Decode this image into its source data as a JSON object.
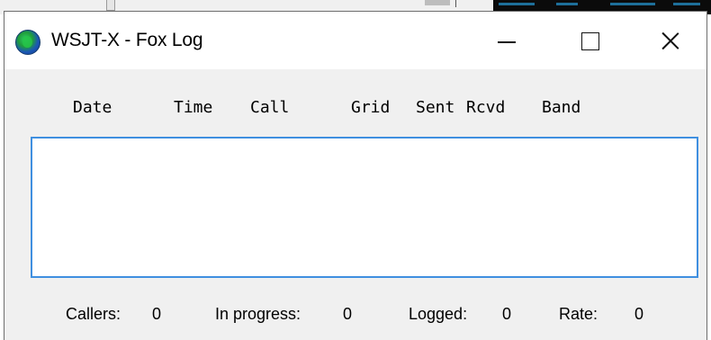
{
  "window": {
    "title": "WSJT-X - Fox Log",
    "icon": "wsjtx-globe-icon",
    "controls": [
      "minimize-icon",
      "maximize-icon",
      "close-icon"
    ]
  },
  "log": {
    "columns": [
      "Date",
      "Time",
      "Call",
      "Grid",
      "Sent",
      "Rcvd",
      "Band"
    ],
    "rows": []
  },
  "status": {
    "callers_label": "Callers:",
    "callers_value": "0",
    "in_progress_label": "In progress:",
    "in_progress_value": "0",
    "logged_label": "Logged:",
    "logged_value": "0",
    "rate_label": "Rate:",
    "rate_value": "0"
  },
  "colors": {
    "accent_border": "#3f8fe0",
    "dialog_background": "#f0f0f0",
    "titlebar_background": "#ffffff"
  }
}
